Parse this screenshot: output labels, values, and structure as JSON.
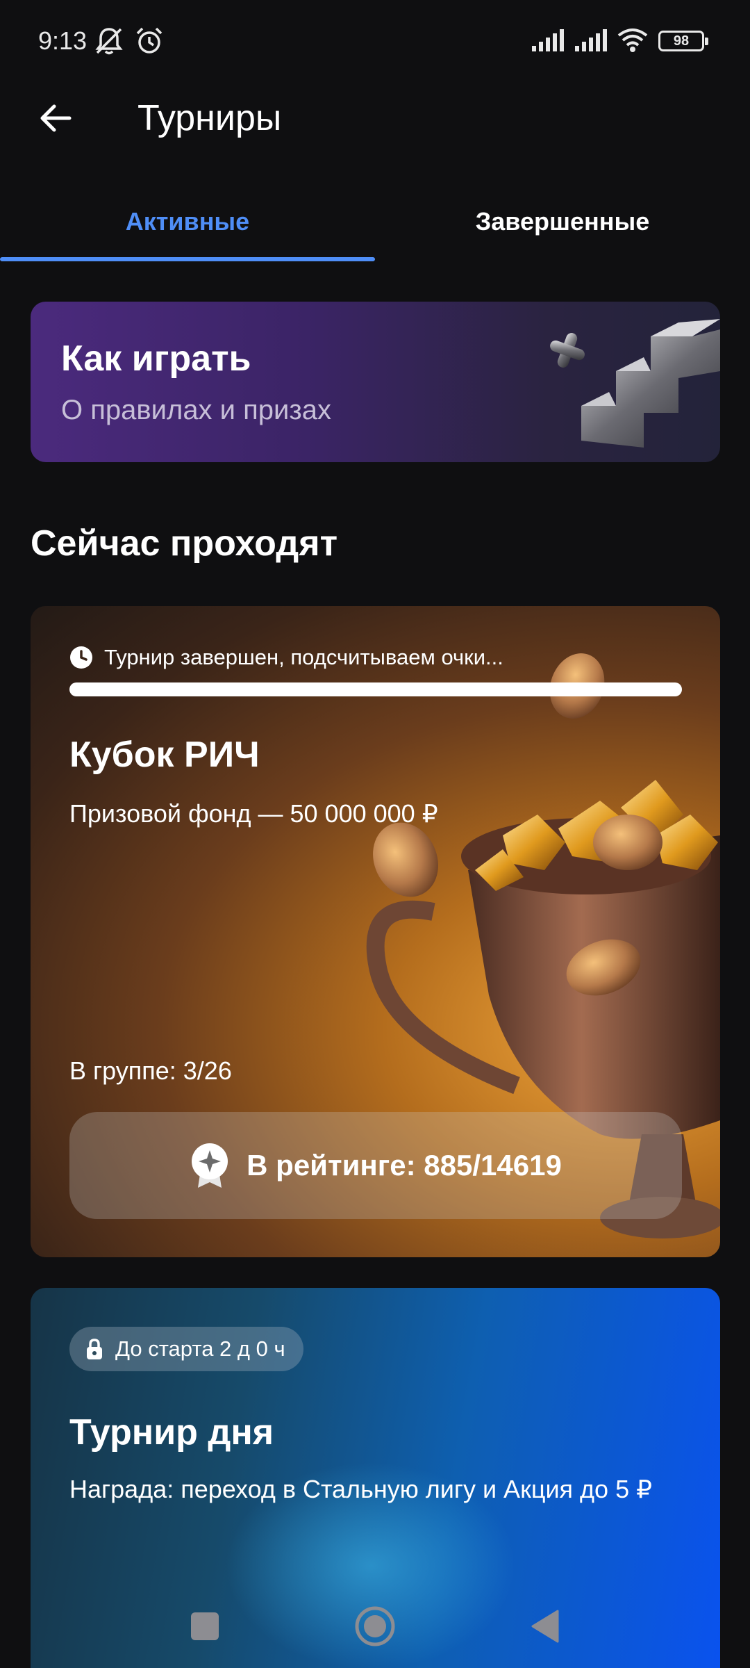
{
  "status_bar": {
    "time": "9:13",
    "battery": "98",
    "icons": [
      "notifications-muted-icon",
      "alarm-icon",
      "signal-icon",
      "signal-icon",
      "wifi-icon",
      "battery-icon"
    ]
  },
  "header": {
    "title": "Турниры",
    "back_icon": "arrow-left-icon"
  },
  "tabs": [
    {
      "label": "Активные",
      "active": true
    },
    {
      "label": "Завершенные",
      "active": false
    }
  ],
  "howto": {
    "title": "Как играть",
    "subtitle": "О правилах и призах"
  },
  "section": {
    "title": "Сейчас проходят"
  },
  "cup_card": {
    "status": "Турнир завершен, подсчитываем очки...",
    "progress": 1.0,
    "title": "Кубок РИЧ",
    "prize": "Призовой фонд — 50 000 000 ₽",
    "group": "В группе: 3/26",
    "rating": "В рейтинге: 885/14619"
  },
  "day_card": {
    "badge": "До старта 2 д 0 ч",
    "title": "Турнир дня",
    "reward": "Награда: переход в Стальную лигу и Акция до 5 ₽"
  },
  "colors": {
    "accent": "#4f8ef7",
    "background": "#0f0f11"
  },
  "navbar": {
    "icons": [
      "recents-square-icon",
      "home-circle-icon",
      "back-triangle-icon"
    ]
  }
}
